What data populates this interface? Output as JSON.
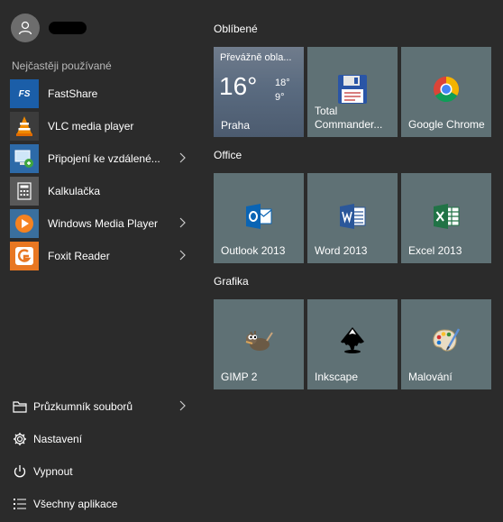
{
  "user": {
    "avatar_icon": "user-icon"
  },
  "most_used": {
    "title": "Nejčastěji používané",
    "items": [
      {
        "label": "FastShare",
        "icon": "fastshare-icon",
        "has_submenu": false
      },
      {
        "label": "VLC media player",
        "icon": "vlc-icon",
        "has_submenu": false
      },
      {
        "label": "Připojení ke vzdálené...",
        "icon": "remote-desktop-icon",
        "has_submenu": true
      },
      {
        "label": "Kalkulačka",
        "icon": "calculator-icon",
        "has_submenu": false
      },
      {
        "label": "Windows Media Player",
        "icon": "media-player-icon",
        "has_submenu": true
      },
      {
        "label": "Foxit Reader",
        "icon": "foxit-icon",
        "has_submenu": true
      }
    ]
  },
  "bottom": {
    "items": [
      {
        "label": "Průzkumník souborů",
        "icon": "file-explorer-icon",
        "has_submenu": true
      },
      {
        "label": "Nastavení",
        "icon": "gear-icon",
        "has_submenu": false
      },
      {
        "label": "Vypnout",
        "icon": "power-icon",
        "has_submenu": false
      },
      {
        "label": "Všechny aplikace",
        "icon": "all-apps-icon",
        "has_submenu": false
      }
    ]
  },
  "groups": {
    "favorites": {
      "title": "Oblíbené",
      "weather": {
        "condition": "Převážně obla...",
        "temp": "16°",
        "high": "18°",
        "low": "9°",
        "city": "Praha"
      },
      "total_commander": "Total Commander...",
      "chrome": "Google Chrome"
    },
    "office": {
      "title": "Office",
      "outlook": "Outlook 2013",
      "word": "Word 2013",
      "excel": "Excel 2013"
    },
    "graphics": {
      "title": "Grafika",
      "gimp": "GIMP 2",
      "inkscape": "Inkscape",
      "paint": "Malování"
    }
  },
  "colors": {
    "background": "#2b2b2b",
    "tile": "#5f7175",
    "weather_tile": "#5a6b80"
  }
}
